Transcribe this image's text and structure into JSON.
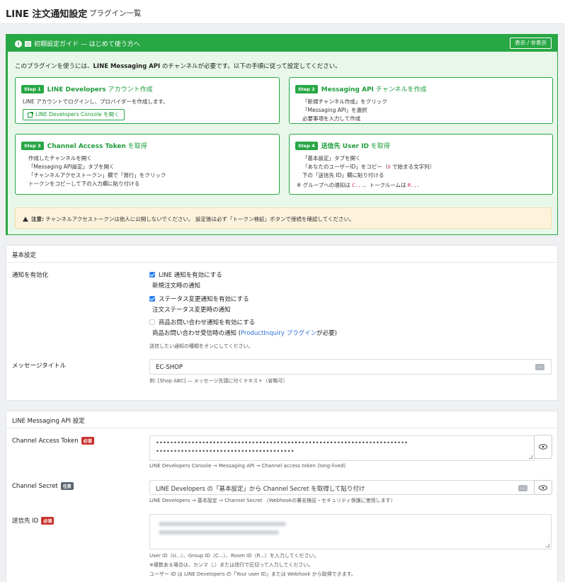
{
  "header": {
    "app_title": "LINE 注文通知設定",
    "page_subtitle": "プラグイン一覧"
  },
  "guide": {
    "title": "初期設定ガイド — はじめて使う方へ",
    "toggle_label": "表示 / 非表示",
    "intro_pre": "このプラグインを使うには、",
    "intro_bold": "LINE Messaging API",
    "intro_post": " のチャンネルが必要です。以下の手順に従って設定してください。",
    "steps": [
      {
        "badge": "Step 1",
        "title_bold": "LINE Developers",
        "title_rest": " アカウント作成",
        "lines": [
          "LINE アカウントでログインし、プロバイダーを作成します。"
        ],
        "link_label": "LINE Developers Console を開く"
      },
      {
        "badge": "Step 2",
        "title_bold": "Messaging API",
        "title_rest": " チャンネルを作成",
        "lines": [
          "「新規チャンネル作成」をクリック",
          "「Messaging API」を選択",
          "必要事項を入力して作成"
        ]
      },
      {
        "badge": "Step 3",
        "title_bold": "Channel Access Token",
        "title_rest": " を取得",
        "lines": [
          "作成したチャンネルを開く",
          "「Messaging API設定」タブを開く",
          "「チャンネルアクセストークン」欄で「発行」をクリック",
          "トークンをコピーして下の入力欄に貼り付ける"
        ]
      },
      {
        "badge": "Step 4",
        "title_bold": "送信先 User ID",
        "title_rest": " を取得",
        "lines": [
          "「基本設定」タブを開く",
          "下の「送信先 ID」欄に貼り付ける"
        ],
        "line2_pre": "「あなたのユーザーID」をコピー（",
        "line2_code": "U",
        "line2_post": " で始まる文字列）",
        "note_pre": "※ グループへの通知は ",
        "note_code1": "C...",
        "note_mid": "、トークルームは ",
        "note_code2": "R..."
      }
    ],
    "warning_bold": "注意:",
    "warning_text": " チャンネルアクセストークンは他人に公開しないでください。 設定後は必ず「トークン検証」ボタンで接続を確認してください。"
  },
  "basic": {
    "section_title": "基本設定",
    "enable_label": "通知を有効化",
    "options": [
      {
        "label": "LINE 通知を有効にする",
        "desc": "新規注文時の通知",
        "checked": true
      },
      {
        "label": "ステータス変更通知を有効にする",
        "desc": "注文ステータス変更時の通知",
        "checked": true
      },
      {
        "label": "商品お問い合わせ通知を有効にする",
        "desc_pre": "商品お問い合わせ受信時の通知 (",
        "desc_link": "ProductInquiry プラグイン",
        "desc_post": "が必要)",
        "checked": false
      }
    ],
    "options_help": "送信したい通知の種類をオンにしてください。",
    "title_label": "メッセージタイトル",
    "title_value": "EC-SHOP",
    "title_help": "例: [Shop ABC] — メッセージ先頭に付くテキスト（省略可）"
  },
  "api": {
    "section_title": "LINE Messaging API 設定",
    "token_label": "Channel Access Token",
    "required_badge": "必須",
    "token_mask_1": "•••••••••••••••••••••••••••••••••••••••••••••••••••••••••••••••••••••••",
    "token_mask_2": "•••••••••••••••••••••••••••••••••••••••",
    "token_help": "LINE Developers Console → Messaging API → Channel access token (long-lived)",
    "secret_label": "Channel Secret",
    "optional_badge": "任意",
    "secret_placeholder": "LINE Developers の「基本設定」から Channel Secret を取得して貼り付け",
    "secret_help": "LINE Developers → 基本設定 → Channel Secret （Webhookの署名検証・セキュリティ保護に使用します）",
    "dest_label": "送信先 ID",
    "dest_help_1": "User ID（U...）、Group ID（C...）、Room ID（R...）を入力してください。",
    "dest_help_2": "※複数ある場合は、カンマ（,）または改行で区切って入力してください。",
    "dest_help_3": "ユーザー ID は LINE Developers の「Your user ID」または Webhook から取得できます。"
  },
  "colors": {
    "accent_green": "#28a745",
    "required_red": "#c9302c",
    "checkbox_blue": "#2d7ff0"
  }
}
